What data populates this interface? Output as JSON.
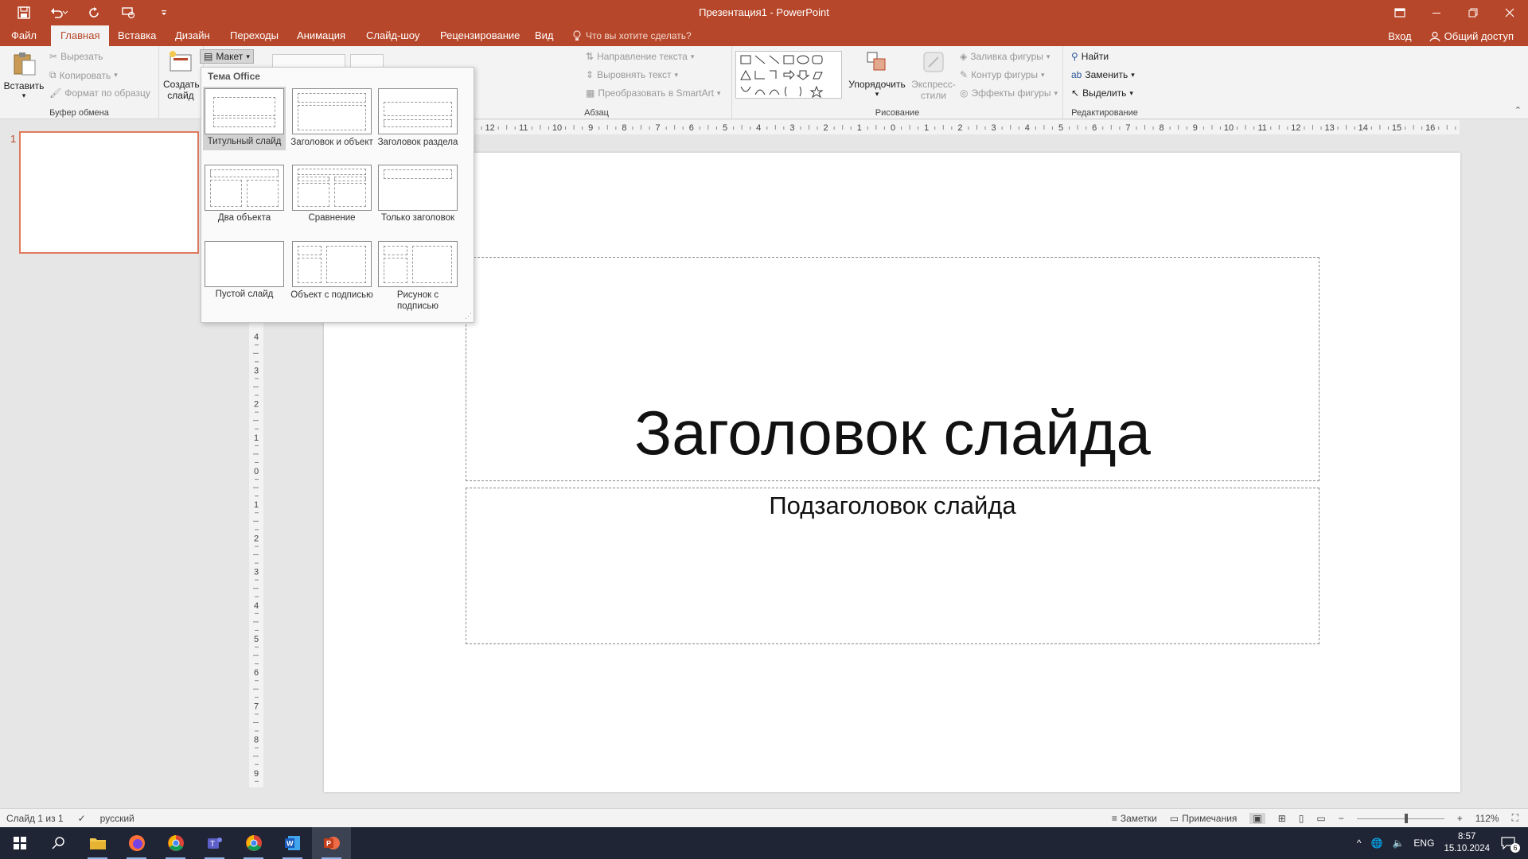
{
  "window": {
    "title": "Презентация1 - PowerPoint"
  },
  "tabs": [
    {
      "label": "Файл"
    },
    {
      "label": "Главная"
    },
    {
      "label": "Вставка"
    },
    {
      "label": "Дизайн"
    },
    {
      "label": "Переходы"
    },
    {
      "label": "Анимация"
    },
    {
      "label": "Слайд-шоу"
    },
    {
      "label": "Рецензирование"
    },
    {
      "label": "Вид"
    }
  ],
  "tell_me": "Что вы хотите сделать?",
  "sign_in": "Вход",
  "share": "Общий доступ",
  "ribbon": {
    "clipboard": {
      "paste": "Вставить",
      "cut": "Вырезать",
      "copy": "Копировать",
      "format_painter": "Формат по образцу",
      "label": "Буфер обмена"
    },
    "slides": {
      "new_slide": "Создать слайд",
      "layout": "Макет"
    },
    "paragraph": {
      "text_direction": "Направление текста",
      "align_text": "Выровнять текст",
      "convert_smartart": "Преобразовать в SmartArt",
      "label": "Абзац"
    },
    "drawing": {
      "arrange": "Упорядочить",
      "quick_styles": "Экспресс-стили",
      "shape_fill": "Заливка фигуры",
      "shape_outline": "Контур фигуры",
      "shape_effects": "Эффекты фигуры",
      "label": "Рисование"
    },
    "editing": {
      "find": "Найти",
      "replace": "Заменить",
      "select": "Выделить",
      "label": "Редактирование"
    }
  },
  "layout_menu": {
    "header": "Тема Office",
    "items": [
      {
        "label": "Титульный слайд",
        "selected": true
      },
      {
        "label": "Заголовок и объект"
      },
      {
        "label": "Заголовок раздела"
      },
      {
        "label": "Два объекта"
      },
      {
        "label": "Сравнение"
      },
      {
        "label": "Только заголовок"
      },
      {
        "label": "Пустой слайд"
      },
      {
        "label": "Объект с подписью"
      },
      {
        "label": "Рисунок с подписью"
      }
    ]
  },
  "thumbnail": {
    "number": "1"
  },
  "slide": {
    "title": "Заголовок слайда",
    "subtitle": "Подзаголовок слайда"
  },
  "status": {
    "slide_count": "Слайд 1 из 1",
    "language": "русский",
    "notes": "Заметки",
    "comments": "Примечания",
    "zoom": "112%"
  },
  "taskbar": {
    "lang": "ENG",
    "time": "8:57",
    "date": "15.10.2024",
    "notifications": "6"
  },
  "colors": {
    "accent": "#b7472a",
    "taskbar": "#1f2535"
  }
}
